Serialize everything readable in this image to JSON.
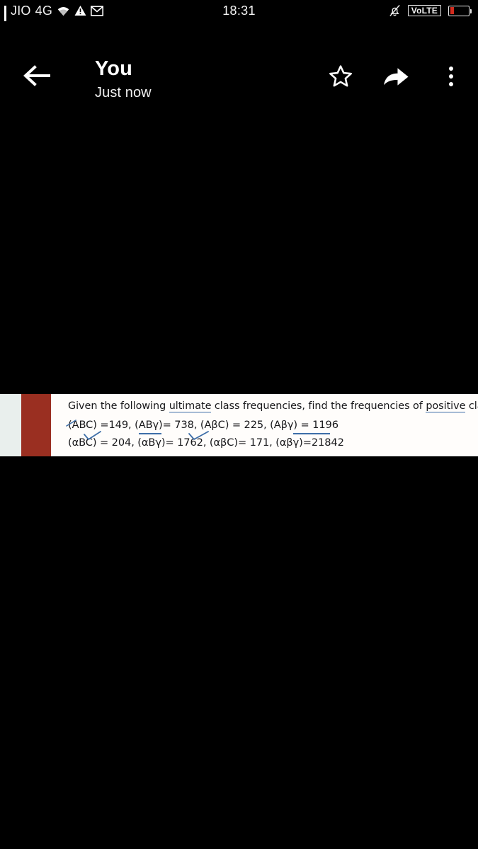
{
  "status_bar": {
    "carrier": "JIO",
    "network": "4G",
    "time": "18:31",
    "volte_label": "VoLTE",
    "icons": {
      "signal": "signal-bars-icon",
      "wifi": "wifi-icon",
      "warning": "warning-triangle-icon",
      "mail": "gmail-envelope-icon",
      "silent": "bell-muted-icon",
      "battery": "battery-low-icon"
    },
    "battery_level_percent": 22,
    "battery_color": "#d32b1e"
  },
  "app_bar": {
    "back_icon": "arrow-left-icon",
    "title": "You",
    "subtitle": "Just now",
    "actions": [
      {
        "name": "star-icon",
        "label": "Star"
      },
      {
        "name": "share-icon",
        "label": "Share"
      },
      {
        "name": "more-vertical-icon",
        "label": "More options"
      }
    ]
  },
  "message": {
    "image": {
      "left_strip_color": "#e9efed",
      "accent_band_color": "#9a2f21",
      "page_color": "#fffdfb",
      "line1": "Given the following ultimate class frequencies, find the frequencies of positive class.",
      "line1_parts": {
        "a": "Given the following ",
        "underlined1": "ultimate",
        "b": " class frequencies, find the frequencies of ",
        "underlined2": "positive",
        "c": " class."
      },
      "line2": "(ABC) =149,    (ABγ)= 738,    (AβC) = 225,    (Aβγ) = 1196",
      "line3": "(αBC) = 204,   (αBγ)= 1762,  (αβC)= 171,   (αβγ)=21842",
      "annotation_color": "#3e6ea8",
      "frequencies": [
        {
          "class": "(ABC)",
          "value": "149"
        },
        {
          "class": "(ABγ)",
          "value": "738"
        },
        {
          "class": "(AβC)",
          "value": "225"
        },
        {
          "class": "(Aβγ)",
          "value": "1196"
        },
        {
          "class": "(αBC)",
          "value": "204"
        },
        {
          "class": "(αBγ)",
          "value": "1762"
        },
        {
          "class": "(αβC)",
          "value": "171"
        },
        {
          "class": "(αβγ)",
          "value": "21842"
        }
      ]
    }
  }
}
